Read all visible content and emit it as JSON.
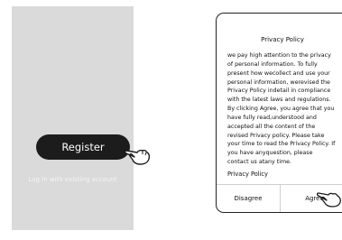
{
  "left_screen": {
    "register_label": "Register",
    "login_link": "Log in with existing account"
  },
  "privacy_dialog": {
    "title": "Privacy Policy",
    "body_lines": [
      "we pay high attention to the privacy",
      "of personal information. To fully",
      "present how wecollect and use your",
      "personal information, werevised the",
      "Privacy Policy indetail in compliance",
      "with the latest laws and regulations.",
      "By clicking Agree, you agree that you",
      "have fully read,understood and",
      "accepted all the content of the",
      "revised Privacy policy. Please take",
      "your time to read the Privacy Policy. If",
      "you have anyquestion, please",
      "contact us atany time."
    ],
    "footer_title": "Privacy Policy",
    "disagree_label": "Disagree",
    "agree_label": "Agree"
  },
  "colors": {
    "left_background": "#dadada",
    "register_button": "#1c1c1c",
    "text_white": "#ffffff"
  }
}
